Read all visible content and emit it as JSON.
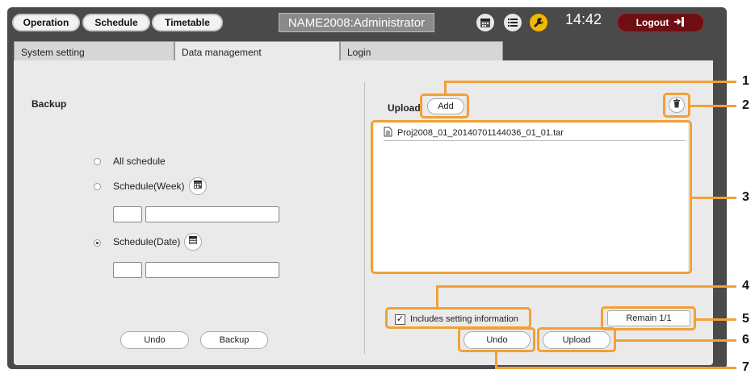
{
  "header": {
    "nav": [
      "Operation",
      "Schedule",
      "Timetable"
    ],
    "title": "NAME2008:Administrator",
    "time": "14:42",
    "logout_label": "Logout"
  },
  "tabs": [
    {
      "label": "System setting",
      "active": false
    },
    {
      "label": "Data management",
      "active": true
    },
    {
      "label": "Login",
      "active": false
    }
  ],
  "backup": {
    "title": "Backup",
    "options": [
      {
        "label": "All schedule",
        "selected": false
      },
      {
        "label": "Schedule(Week)",
        "selected": false
      },
      {
        "label": "Schedule(Date)",
        "selected": true
      }
    ],
    "undo_label": "Undo",
    "backup_label": "Backup"
  },
  "upload": {
    "title": "Upload",
    "add_label": "Add",
    "files": [
      "Proj2008_01_20140701144036_01_01.tar"
    ],
    "includes_setting_label": "Includes setting information",
    "includes_setting_checked": true,
    "remain_label": "Remain 1/1",
    "undo_label": "Undo",
    "upload_label": "Upload"
  },
  "callouts": [
    "1",
    "2",
    "3",
    "4",
    "5",
    "6",
    "7"
  ],
  "colors": {
    "callout": "#f2a037",
    "logout": "#6e0f13",
    "frame": "#4a4a4a",
    "panel": "#eaeaea"
  }
}
